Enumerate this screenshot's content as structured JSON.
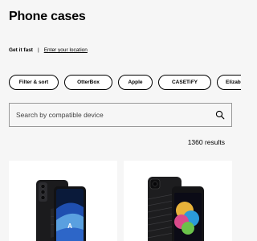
{
  "page": {
    "title": "Phone cases"
  },
  "fulfillment": {
    "fast_label": "Get it fast",
    "separator": "|",
    "location_link": "Enter your location"
  },
  "filters": {
    "primary": "Filter & sort",
    "chips": [
      "OtterBox",
      "Apple",
      "CASETiFY",
      "Elizab"
    ]
  },
  "search": {
    "placeholder": "Search by compatible device",
    "icon": "search-icon"
  },
  "results": {
    "count_text": "1360 results"
  },
  "products": [
    {
      "image": "samsung-galaxy-case-image"
    },
    {
      "image": "iphone-case-image"
    }
  ],
  "colors": {
    "background": "#f6f6f6",
    "card": "#ffffff",
    "text": "#000000"
  }
}
